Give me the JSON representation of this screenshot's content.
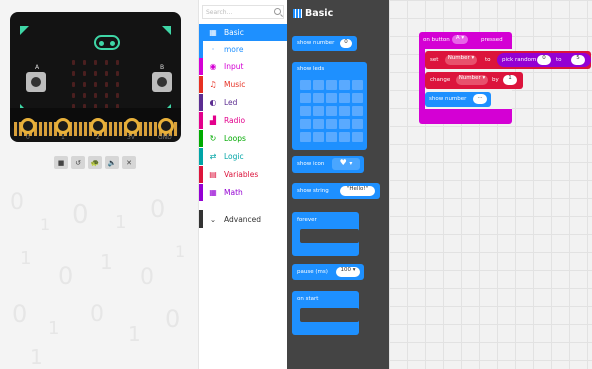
{
  "simulator": {
    "labels": {
      "a": "A",
      "b": "B"
    },
    "pins": [
      "0",
      "1",
      "2",
      "3V",
      "GND"
    ],
    "toolbar": [
      "■",
      "↺",
      "🐢",
      "🔈",
      "✕"
    ],
    "background_glyphs": [
      "0",
      "1",
      "0",
      "1",
      "0",
      "1",
      "0",
      "1",
      "0",
      "1",
      "0",
      "1",
      "0",
      "1",
      "0",
      "1"
    ]
  },
  "toolbox": {
    "search_placeholder": "Search...",
    "categories": [
      {
        "label": "Basic",
        "color": "#1e90ff",
        "icon": "▦"
      },
      {
        "label": "Input",
        "color": "#d400d4",
        "icon": "◉"
      },
      {
        "label": "Music",
        "color": "#e63022",
        "icon": "♫"
      },
      {
        "label": "Led",
        "color": "#5c2d91",
        "icon": "◐"
      },
      {
        "label": "Radio",
        "color": "#e3008c",
        "icon": "▟"
      },
      {
        "label": "Loops",
        "color": "#00aa00",
        "icon": "↻"
      },
      {
        "label": "Logic",
        "color": "#00a4a6",
        "icon": "⇄"
      },
      {
        "label": "Variables",
        "color": "#dc143c",
        "icon": "▤"
      },
      {
        "label": "Math",
        "color": "#9400d3",
        "icon": "▦"
      }
    ],
    "more_label": "more",
    "advanced": {
      "label": "Advanced",
      "icon": "⌄"
    }
  },
  "flyout": {
    "title": "Basic",
    "blocks": {
      "show_number": {
        "label": "show number",
        "value": "0"
      },
      "show_leds": {
        "label": "show leds"
      },
      "show_icon": {
        "label": "show icon",
        "icon": "♥",
        "arrow": "▾"
      },
      "show_string": {
        "label": "show string",
        "value": "\"Hello!\""
      },
      "forever": {
        "label": "forever"
      },
      "pause": {
        "label": "pause (ms)",
        "value": "100 ▾"
      },
      "on_start": {
        "label": "on start"
      }
    }
  },
  "workspace": {
    "event": {
      "label": "on button",
      "button": "A ▾",
      "suffix": "pressed",
      "color": "#d400d4"
    },
    "set_block": {
      "label": "set",
      "var": "Number ▾",
      "to": "to",
      "fn": "pick random",
      "from": "0",
      "to_word": "to",
      "max": "5"
    },
    "change_block": {
      "label": "change",
      "var": "Number ▾",
      "by": "by",
      "value": "1"
    },
    "show_number": {
      "label": "show number",
      "var": "..."
    }
  }
}
